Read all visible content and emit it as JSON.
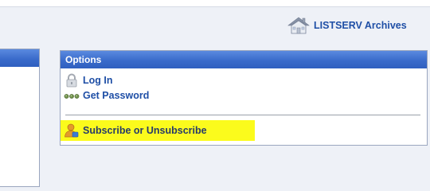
{
  "header": {
    "archives_label": "LISTSERV Archives",
    "archives_icon": "home-icon"
  },
  "options": {
    "title": "Options",
    "items": [
      {
        "label": "Log In",
        "icon": "lock-icon"
      },
      {
        "label": "Get Password",
        "icon": "password-dots-icon"
      },
      {
        "label": "Subscribe or Unsubscribe",
        "icon": "user-icon",
        "highlight": "#fbfb1c"
      }
    ]
  },
  "colors": {
    "link": "#1f4fa6",
    "header_bar": "#3a6bcb",
    "highlight": "#fbfb1c"
  }
}
